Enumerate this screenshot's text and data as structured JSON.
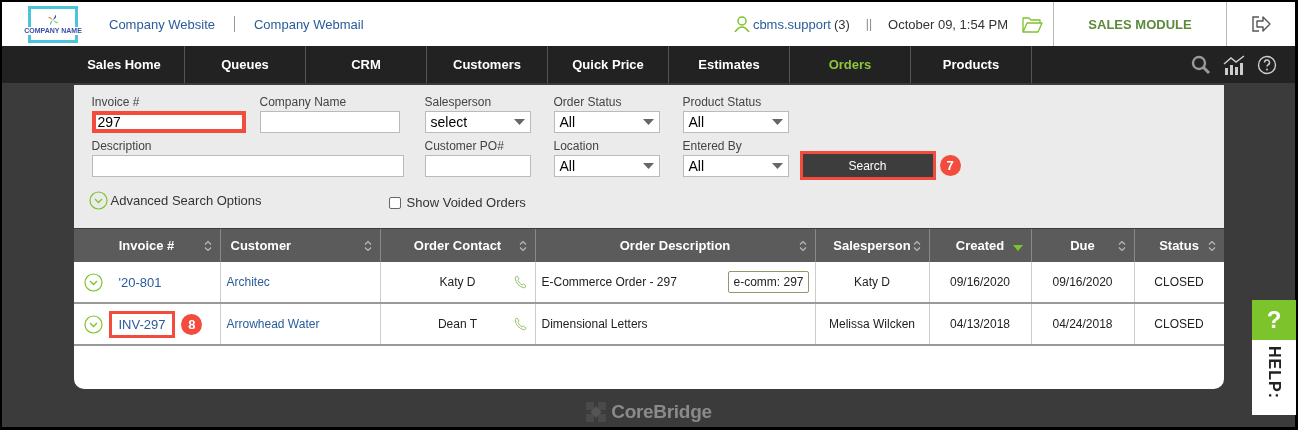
{
  "header": {
    "logo_text": "COMPANY NAME",
    "links": [
      "Company Website",
      "Company Webmail"
    ],
    "user": {
      "name": "cbms.support",
      "count": "(3)"
    },
    "separator": "||",
    "datetime": "October 09, 1:54 PM",
    "module": "SALES MODULE"
  },
  "nav": {
    "items": [
      {
        "label": "Sales Home",
        "selected": false
      },
      {
        "label": "Queues",
        "selected": false
      },
      {
        "label": "CRM",
        "selected": false
      },
      {
        "label": "Customers",
        "selected": false
      },
      {
        "label": "Quick Price",
        "selected": false
      },
      {
        "label": "Estimates",
        "selected": false
      },
      {
        "label": "Orders",
        "selected": true
      },
      {
        "label": "Products",
        "selected": false
      }
    ]
  },
  "filters": {
    "fields": [
      {
        "label": "Invoice #",
        "kind": "text",
        "value": "297",
        "highlighted": true
      },
      {
        "label": "Company Name",
        "kind": "text",
        "highlighted": false
      },
      {
        "label": "Salesperson",
        "kind": "select",
        "value": "select",
        "highlighted": false
      },
      {
        "label": "Order Status",
        "kind": "select",
        "value": "All",
        "highlighted": false
      },
      {
        "label": "Product Status",
        "kind": "select",
        "value": "All",
        "highlighted": false
      },
      {
        "label": "Description",
        "kind": "text",
        "highlighted": false
      },
      {
        "label": "Customer PO#",
        "kind": "text",
        "highlighted": false
      },
      {
        "label": "Location",
        "kind": "select",
        "value": "All",
        "highlighted": false
      },
      {
        "label": "Entered By",
        "kind": "select",
        "value": "All",
        "highlighted": false
      }
    ],
    "search_button": {
      "label": "Search",
      "highlighted": true,
      "callout": "7"
    },
    "advanced_toggle": "Advanced Search Options",
    "show_voided": {
      "label": "Show Voided Orders",
      "checked": false
    }
  },
  "table": {
    "columns": [
      {
        "label": "Invoice #",
        "sorted": false
      },
      {
        "label": "Customer",
        "sorted": false
      },
      {
        "label": "Order Contact",
        "sorted": false
      },
      {
        "label": "Order Description",
        "sorted": false
      },
      {
        "label": "Salesperson",
        "sorted": false
      },
      {
        "label": "Created",
        "sorted": true
      },
      {
        "label": "Due",
        "sorted": false
      },
      {
        "label": "Status",
        "sorted": false
      }
    ],
    "rows": [
      {
        "invoice": "'20-801",
        "highlighted": false,
        "customer": "Architec",
        "contact": "Katy D",
        "description": "E-Commerce Order - 297",
        "tag": "e-comm: 297",
        "salesperson": "Katy D",
        "created": "09/16/2020",
        "due": "09/16/2020",
        "status": "CLOSED"
      },
      {
        "invoice": "INV-297",
        "highlighted": true,
        "callout": "8",
        "customer": "Arrowhead Water",
        "contact": "Dean T",
        "description": "Dimensional Letters",
        "salesperson": "Melissa Wilcken",
        "created": "04/13/2018",
        "due": "04/24/2018",
        "status": "CLOSED"
      }
    ]
  },
  "footer": {
    "brand": "CoreBridge"
  },
  "help": {
    "icon": "?",
    "label": "HELP:"
  }
}
